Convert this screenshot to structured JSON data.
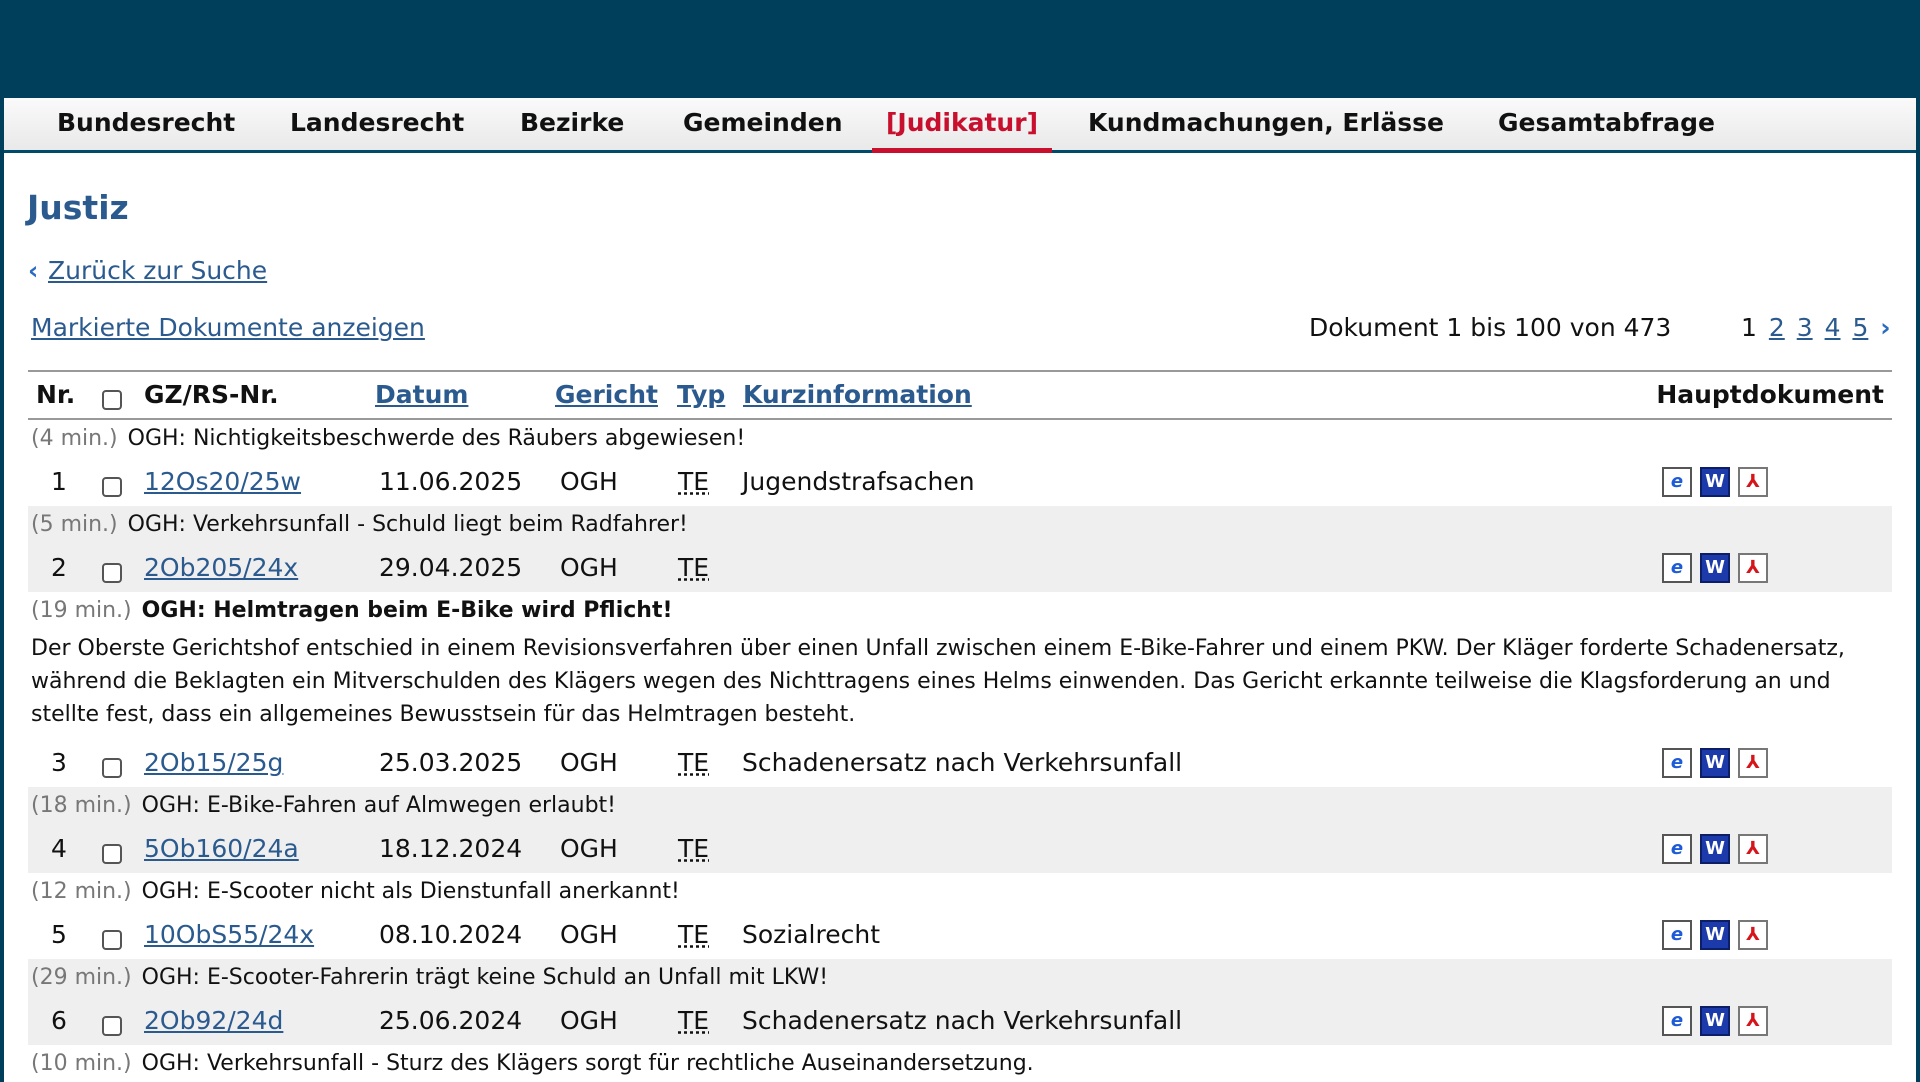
{
  "nav": {
    "items": [
      "Bundesrecht",
      "Landesrecht",
      "Bezirke",
      "Gemeinden",
      "[Judikatur]",
      "Kundmachungen, Erlässe",
      "Gesamtabfrage"
    ]
  },
  "page": {
    "title": "Justiz",
    "back_link": "Zurück zur Suche",
    "marked_link": "Markierte Dokumente anzeigen",
    "doc_count": "Dokument 1 bis 100 von 473",
    "pager": {
      "current": "1",
      "pages": [
        "2",
        "3",
        "4",
        "5"
      ]
    }
  },
  "table": {
    "headers": {
      "nr": "Nr.",
      "gz": "GZ/RS-Nr.",
      "datum": "Datum",
      "gericht": "Gericht",
      "typ": "Typ",
      "kurz": "Kurzinformation",
      "haupt": "Hauptdokument"
    },
    "rows": [
      {
        "time": "(4 min.)",
        "headline": "OGH: Nichtigkeitsbeschwerde des Räubers abgewiesen!",
        "nr": "1",
        "gz": "12Os20/25w",
        "date": "11.06.2025",
        "court": "OGH",
        "type": "TE",
        "kurz": "Jugendstrafsachen"
      },
      {
        "time": "(5 min.)",
        "headline": "OGH: Verkehrsunfall - Schuld liegt beim Radfahrer!",
        "nr": "2",
        "gz": "2Ob205/24x",
        "date": "29.04.2025",
        "court": "OGH",
        "type": "TE",
        "kurz": ""
      },
      {
        "time": "(19 min.)",
        "headline": "OGH: Helmtragen beim E-Bike wird Pflicht!",
        "abstract": "Der Oberste Gerichtshof entschied in einem Revisionsverfahren über einen Unfall zwischen einem E-Bike-Fahrer und einem PKW. Der Kläger forderte Schadenersatz, während die Beklagten ein Mitverschulden des Klägers wegen des Nichttragens eines Helms einwenden. Das Gericht erkannte teilweise die Klagsforderung an und stellte fest, dass ein allgemeines Bewusstsein für das Helmtragen besteht.",
        "nr": "3",
        "gz": "2Ob15/25g",
        "date": "25.03.2025",
        "court": "OGH",
        "type": "TE",
        "kurz": "Schadenersatz nach Verkehrsunfall"
      },
      {
        "time": "(18 min.)",
        "headline": "OGH: E-Bike-Fahren auf Almwegen erlaubt!",
        "nr": "4",
        "gz": "5Ob160/24a",
        "date": "18.12.2024",
        "court": "OGH",
        "type": "TE",
        "kurz": ""
      },
      {
        "time": "(12 min.)",
        "headline": "OGH: E-Scooter nicht als Dienstunfall anerkannt!",
        "nr": "5",
        "gz": "10ObS55/24x",
        "date": "08.10.2024",
        "court": "OGH",
        "type": "TE",
        "kurz": "Sozialrecht"
      },
      {
        "time": "(29 min.)",
        "headline": "OGH: E-Scooter-Fahrerin trägt keine Schuld an Unfall mit LKW!",
        "nr": "6",
        "gz": "2Ob92/24d",
        "date": "25.06.2024",
        "court": "OGH",
        "type": "TE",
        "kurz": "Schadenersatz nach Verkehrsunfall"
      },
      {
        "time": "(10 min.)",
        "headline": "OGH: Verkehrsunfall - Sturz des Klägers sorgt für rechtliche Auseinandersetzung."
      }
    ]
  },
  "icons": {
    "html": "html-document-icon",
    "word": "word-document-icon",
    "pdf": "pdf-document-icon"
  },
  "colors": {
    "header_bg": "#003f5c",
    "active_tab": "#c8102e",
    "link": "#2b5a8f",
    "row_shade": "#efefef"
  }
}
